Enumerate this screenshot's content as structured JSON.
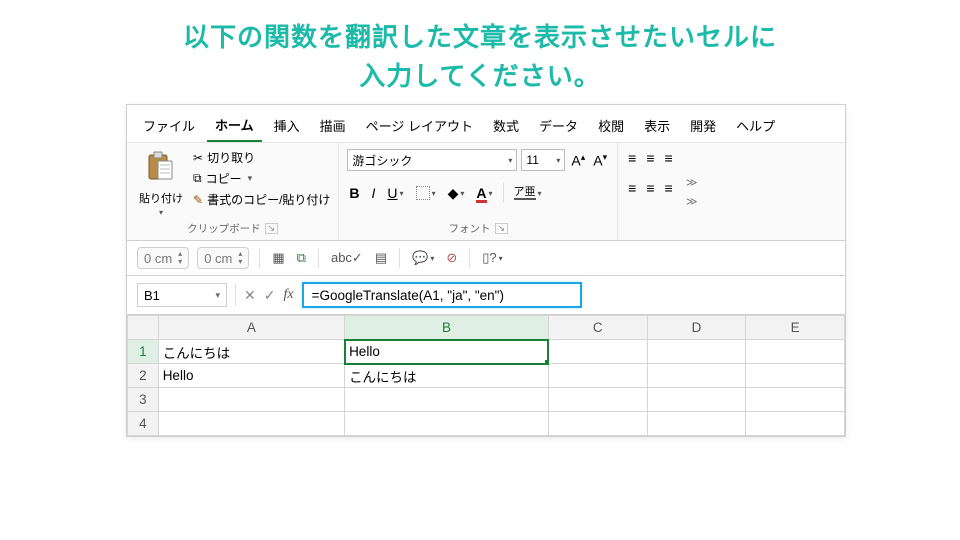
{
  "instruction": {
    "line1": "以下の関数を翻訳した文章を表示させたいセルに",
    "line2": "入力してください。"
  },
  "menu": {
    "file": "ファイル",
    "home": "ホーム",
    "insert": "挿入",
    "draw": "描画",
    "pageLayout": "ページ レイアウト",
    "formulas": "数式",
    "data": "データ",
    "review": "校閲",
    "view": "表示",
    "developer": "開発",
    "help": "ヘルプ"
  },
  "ribbon": {
    "clipboard": {
      "paste": "貼り付け",
      "cut": "切り取り",
      "copy": "コピー",
      "formatPainter": "書式のコピー/貼り付け",
      "groupLabel": "クリップボード"
    },
    "font": {
      "name": "游ゴシック",
      "size": "11",
      "groupLabel": "フォント"
    }
  },
  "quickbar": {
    "cm1": "0 cm",
    "cm2": "0 cm"
  },
  "formulaBar": {
    "nameBox": "B1",
    "formula": "=GoogleTranslate(A1, \"ja\", \"en\")"
  },
  "grid": {
    "cols": [
      "A",
      "B",
      "C",
      "D",
      "E"
    ],
    "rows": [
      {
        "num": "1",
        "A": "こんにちは",
        "B": "Hello",
        "C": "",
        "D": "",
        "E": ""
      },
      {
        "num": "2",
        "A": "Hello",
        "B": "こんにちは",
        "C": "",
        "D": "",
        "E": ""
      },
      {
        "num": "3",
        "A": "",
        "B": "",
        "C": "",
        "D": "",
        "E": ""
      },
      {
        "num": "4",
        "A": "",
        "B": "",
        "C": "",
        "D": "",
        "E": ""
      }
    ],
    "activeCol": "B",
    "activeRow": "1"
  }
}
